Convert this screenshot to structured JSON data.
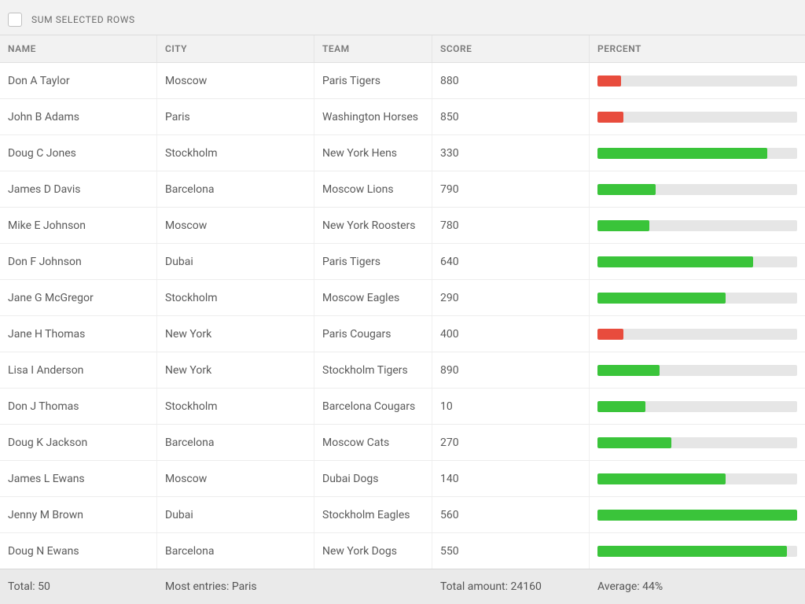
{
  "topbar": {
    "sum_label": "SUM SELECTED ROWS"
  },
  "headers": {
    "name": "NAME",
    "city": "CITY",
    "team": "TEAM",
    "score": "SCORE",
    "percent": "PERCENT"
  },
  "rows": [
    {
      "name": "Don A Taylor",
      "city": "Moscow",
      "team": "Paris Tigers",
      "score": "880",
      "percent": 12,
      "color": "red"
    },
    {
      "name": "John B Adams",
      "city": "Paris",
      "team": "Washington Horses",
      "score": "850",
      "percent": 13,
      "color": "red"
    },
    {
      "name": "Doug C Jones",
      "city": "Stockholm",
      "team": "New York Hens",
      "score": "330",
      "percent": 85,
      "color": "green"
    },
    {
      "name": "James D Davis",
      "city": "Barcelona",
      "team": "Moscow Lions",
      "score": "790",
      "percent": 29,
      "color": "green"
    },
    {
      "name": "Mike E Johnson",
      "city": "Moscow",
      "team": "New York Roosters",
      "score": "780",
      "percent": 26,
      "color": "green"
    },
    {
      "name": "Don F Johnson",
      "city": "Dubai",
      "team": "Paris Tigers",
      "score": "640",
      "percent": 78,
      "color": "green"
    },
    {
      "name": "Jane G McGregor",
      "city": "Stockholm",
      "team": "Moscow Eagles",
      "score": "290",
      "percent": 64,
      "color": "green"
    },
    {
      "name": "Jane H Thomas",
      "city": "New York",
      "team": "Paris Cougars",
      "score": "400",
      "percent": 13,
      "color": "red"
    },
    {
      "name": "Lisa I Anderson",
      "city": "New York",
      "team": "Stockholm Tigers",
      "score": "890",
      "percent": 31,
      "color": "green"
    },
    {
      "name": "Don J Thomas",
      "city": "Stockholm",
      "team": "Barcelona Cougars",
      "score": "10",
      "percent": 24,
      "color": "green"
    },
    {
      "name": "Doug K Jackson",
      "city": "Barcelona",
      "team": "Moscow Cats",
      "score": "270",
      "percent": 37,
      "color": "green"
    },
    {
      "name": "James L Ewans",
      "city": "Moscow",
      "team": "Dubai Dogs",
      "score": "140",
      "percent": 64,
      "color": "green"
    },
    {
      "name": "Jenny M Brown",
      "city": "Dubai",
      "team": "Stockholm Eagles",
      "score": "560",
      "percent": 100,
      "color": "green"
    },
    {
      "name": "Doug N Ewans",
      "city": "Barcelona",
      "team": "New York Dogs",
      "score": "550",
      "percent": 95,
      "color": "green"
    }
  ],
  "footer": {
    "total": "Total: 50",
    "most_entries": "Most entries: Paris",
    "total_amount": "Total amount: 24160",
    "average": "Average: 44%"
  }
}
